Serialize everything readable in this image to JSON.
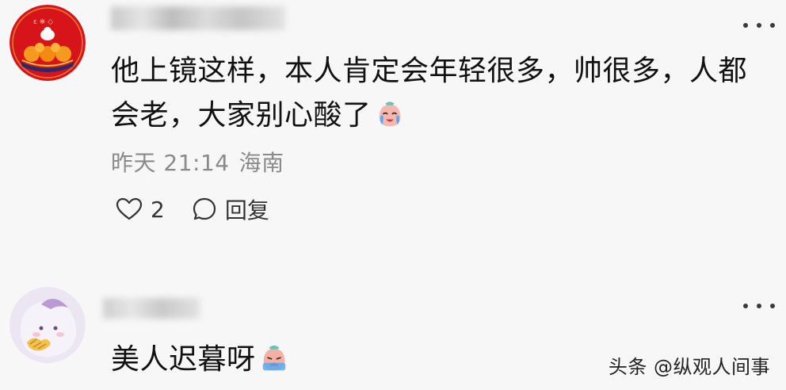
{
  "comments": [
    {
      "text": "他上镜这样，本人肯定会年轻很多，帅很多，人都会老，大家别心酸了",
      "emoji": "crying-face-emoji",
      "time": "昨天 21:14",
      "location": "海南",
      "likes": "2",
      "reply_label": "回复"
    },
    {
      "text": "美人迟暮呀",
      "emoji": "crying-face-emoji"
    }
  ],
  "watermark": "头条 @纵观人间事",
  "colors": {
    "background": "#f7f7f7",
    "text": "#111111",
    "meta_text": "#8a8a8a",
    "avatar1_bg": "#d8141b",
    "avatar2_bg": "#ece6f3"
  }
}
